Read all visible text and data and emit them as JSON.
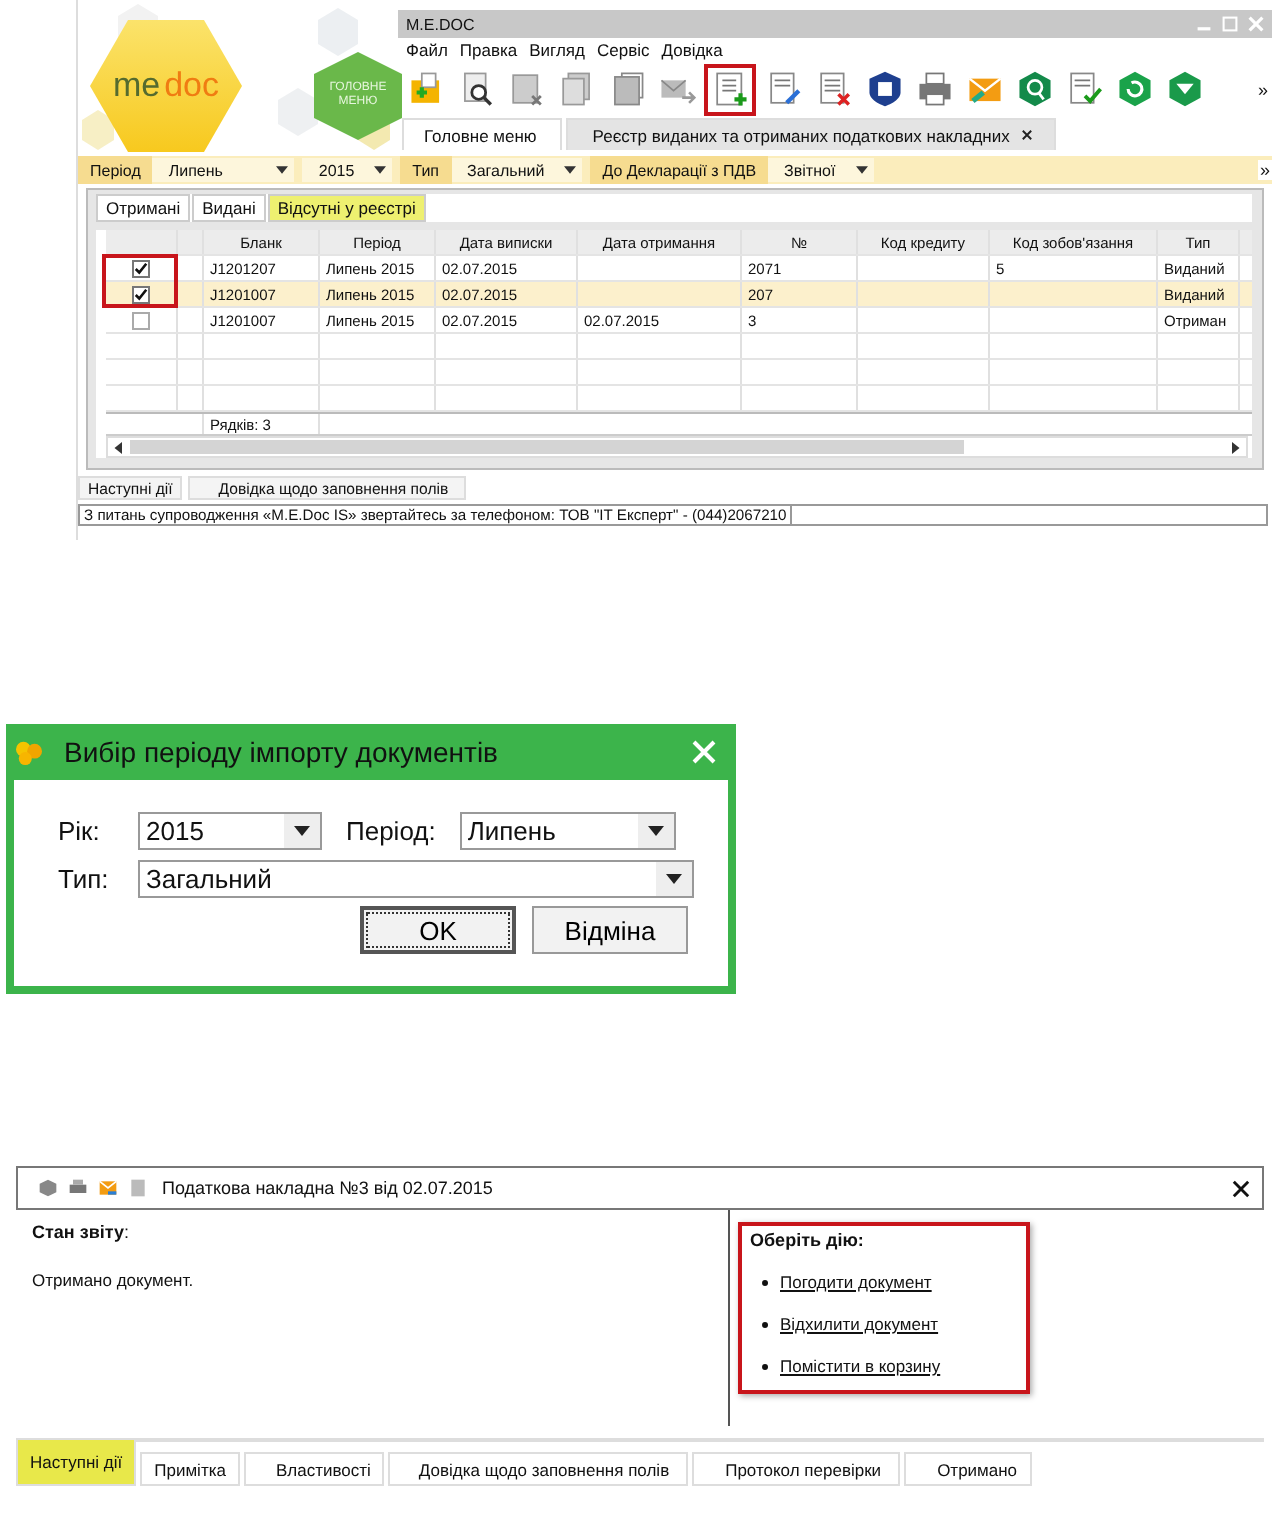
{
  "app": {
    "logo": {
      "part1": "me",
      "part2": "doc"
    },
    "main_menu_button": "ГОЛОВНЕ МЕНЮ",
    "window_title": "M.E.DOC",
    "menu": [
      "Файл",
      "Правка",
      "Вигляд",
      "Сервіс",
      "Довідка"
    ],
    "toolbar": [
      {
        "kind": "folder-add",
        "highlighted": false
      },
      {
        "kind": "doc-search",
        "highlighted": false
      },
      {
        "kind": "doc-grey-delete",
        "highlighted": false
      },
      {
        "kind": "docs-copy",
        "highlighted": false
      },
      {
        "kind": "doc-edit",
        "highlighted": false
      },
      {
        "kind": "envelope-send",
        "highlighted": false
      },
      {
        "kind": "doc-add",
        "highlighted": true
      },
      {
        "kind": "doc-pen",
        "highlighted": false
      },
      {
        "kind": "doc-delete",
        "highlighted": false
      },
      {
        "kind": "shield",
        "highlighted": false
      },
      {
        "kind": "printer",
        "highlighted": false
      },
      {
        "kind": "envelope",
        "highlighted": false
      },
      {
        "kind": "hex-search",
        "highlighted": false
      },
      {
        "kind": "doc-check",
        "highlighted": false
      },
      {
        "kind": "hex-refresh",
        "highlighted": false
      },
      {
        "kind": "hex-download",
        "highlighted": false
      }
    ],
    "toolbar_more": "»",
    "tabs": [
      {
        "label": "Головне меню",
        "selected": false
      },
      {
        "label": "Реєстр виданих та отриманих податкових накладних",
        "selected": true
      }
    ],
    "filters": [
      {
        "label": "Період",
        "value": "Липень"
      },
      {
        "value": "2015"
      },
      {
        "label": "Тип",
        "value": "Загальний"
      },
      {
        "label": "До Декларації з ПДВ",
        "value": "Звітної"
      }
    ],
    "filters_more": "»",
    "subtabs": [
      {
        "label": "Отримані",
        "selected": false
      },
      {
        "label": "Видані",
        "selected": false
      },
      {
        "label": "Відсутні у реєстрі",
        "selected": true
      }
    ],
    "table": {
      "columns": [
        "Бланк",
        "Період",
        "Дата виписки",
        "Дата отримання",
        "№",
        "Код кредиту",
        "Код зобов'язання",
        "Тип"
      ],
      "rows": [
        {
          "checked": true,
          "selected": false,
          "cells": [
            "J1201207",
            "Липень 2015",
            "02.07.2015",
            "",
            "2071",
            "",
            "5",
            "Виданий"
          ]
        },
        {
          "checked": true,
          "selected": true,
          "cells": [
            "J1201007",
            "Липень 2015",
            "02.07.2015",
            "",
            "207",
            "",
            "",
            "Виданий"
          ]
        },
        {
          "checked": false,
          "selected": false,
          "cells": [
            "J1201007",
            "Липень 2015",
            "02.07.2015",
            "02.07.2015",
            "3",
            "",
            "",
            "Отриман"
          ]
        }
      ],
      "checkboxes_highlighted": true,
      "footer": "Рядків: 3"
    },
    "bottom_tabs": [
      "Наступні дії",
      "Довідка щодо заповнення полів"
    ],
    "status": "З питань супроводження «M.E.Doc IS» звертайтесь за телефоном: ТОВ \"IT Експерт\" - (044)2067210"
  },
  "dialog": {
    "title": "Вибір періоду імпорту документів",
    "year_label": "Рік:",
    "year": "2015",
    "period_label": "Період:",
    "period": "Липень",
    "type_label": "Тип:",
    "type": "Загальний",
    "buttons": [
      "OK",
      "Відміна"
    ]
  },
  "document": {
    "title": "Податкова накладна  №3 від 02.07.2015",
    "icons": [
      {
        "kind": "cube"
      },
      {
        "kind": "printer"
      },
      {
        "kind": "envelope"
      },
      {
        "kind": "doc"
      }
    ],
    "status_label": "**Стан звіту**:",
    "status_text": "Отримано документ.",
    "actions_title": "Оберіть дію:",
    "actions_highlighted": true,
    "actions": [
      "Погодити документ",
      "Відхилити документ",
      "Помістити в корзину"
    ],
    "tabs": [
      {
        "label": "Наступні дії",
        "selected": true
      },
      {
        "label": "Примітка",
        "selected": false
      },
      {
        "label": "Властивості",
        "selected": false
      },
      {
        "label": "Довідка щодо заповнення полів",
        "selected": false
      },
      {
        "label": "Протокол перевірки",
        "selected": false
      },
      {
        "label": "Отримано",
        "selected": false
      }
    ]
  }
}
